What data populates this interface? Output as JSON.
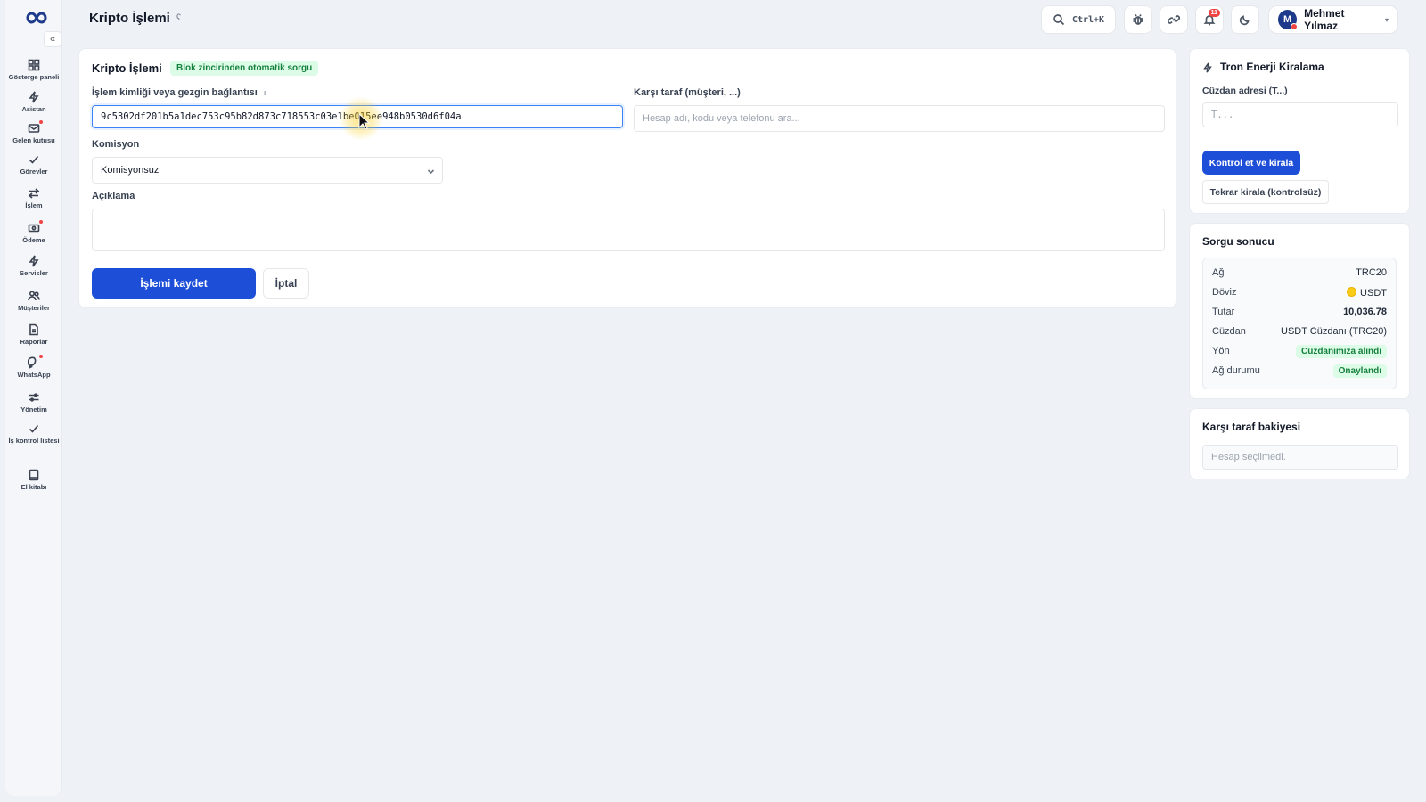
{
  "sidebar": {
    "collapse_glyph": "«",
    "items": [
      {
        "label": "Gösterge paneli",
        "icon": "dashboard-icon"
      },
      {
        "label": "Asistan",
        "icon": "bolt-icon"
      },
      {
        "label": "Gelen kutusu",
        "icon": "inbox-icon"
      },
      {
        "label": "Görevler",
        "icon": "check-icon"
      },
      {
        "label": "İşlem",
        "icon": "swap-icon"
      },
      {
        "label": "Ödeme",
        "icon": "payment-icon"
      },
      {
        "label": "Servisler",
        "icon": "bolt-icon"
      },
      {
        "label": "Müşteriler",
        "icon": "users-icon"
      },
      {
        "label": "Raporlar",
        "icon": "report-icon"
      },
      {
        "label": "WhatsApp",
        "icon": "chat-icon"
      },
      {
        "label": "Yönetim",
        "icon": "sliders-icon"
      },
      {
        "label": "İş kontrol listesi",
        "icon": "check-icon"
      },
      {
        "label": "El kitabı",
        "icon": "book-icon"
      }
    ]
  },
  "header": {
    "title": "Kripto İşlemi",
    "help_glyph": "ʕ",
    "search_shortcut": "Ctrl+K",
    "notifications_count": "11",
    "user": {
      "initial": "M",
      "name": "Mehmet Yılmaz",
      "caret": "▾"
    }
  },
  "form": {
    "title": "Kripto İşlemi",
    "badge": "Blok zincirinden otomatik sorgu",
    "tx_label": "İşlem kimliği veya gezgin bağlantısı",
    "tx_help": "ı",
    "tx_value": "9c5302df201b5a1dec753c95b82d873c718553c03e1be015ee948b0530d6f04a",
    "counterparty_label": "Karşı taraf (müşteri, ...)",
    "counterparty_placeholder": "Hesap adı, kodu veya telefonu ara...",
    "commission_label": "Komisyon",
    "commission_value": "Komisyonsuz",
    "description_label": "Açıklama",
    "save_label": "İşlemi kaydet",
    "cancel_label": "İptal"
  },
  "tron": {
    "title": "Tron Enerji Kiralama",
    "wallet_label": "Cüzdan adresi (T...)",
    "wallet_placeholder": "T...",
    "check_rent_label": "Kontrol et ve kirala",
    "rerent_label": "Tekrar kirala (kontrolsüz)"
  },
  "result": {
    "title": "Sorgu sonucu",
    "rows": [
      {
        "key": "Ağ",
        "value": "TRC20"
      },
      {
        "key": "Döviz",
        "value": "USDT"
      },
      {
        "key": "Tutar",
        "value": "10,036.78"
      },
      {
        "key": "Cüzdan",
        "value": "USDT Cüzdanı (TRC20)"
      },
      {
        "key": "Yön",
        "value": "Cüzdanımıza alındı"
      },
      {
        "key": "Ağ durumu",
        "value": "Onaylandı"
      }
    ]
  },
  "balance": {
    "title": "Karşı taraf bakiyesi",
    "empty_text": "Hesap seçilmedi."
  },
  "colors": {
    "accent": "#1d4ed8",
    "success_bg": "#dcfce7",
    "success_text": "#15803d",
    "badge_red": "#ef4444"
  }
}
